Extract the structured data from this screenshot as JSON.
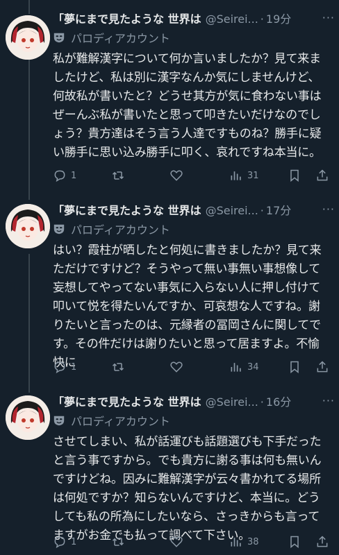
{
  "tweets": [
    {
      "display_name": "「夢にまで見たような 世界は",
      "handle": "@Seirei...",
      "separator": "·",
      "time": "19分",
      "label": "パロディアカウント",
      "text": "私が難解漢字について何か言いましたか？見て来ましたけど、私は別に漢字なんか気にしませんけど、何故私が書いたと？どうせ其方が気に食わない事はぜーんぶ私が書いたと思って叩きたいだけなのでしょう？貴方達はそう言う人達ですものね？勝手に疑い勝手に思い込み勝手に叩く、哀れですね本当に。",
      "replies": "1",
      "views": "31"
    },
    {
      "display_name": "「夢にまで見たような 世界は",
      "handle": "@Seirei...",
      "separator": "·",
      "time": "17分",
      "label": "パロディアカウント",
      "text": "はい？霞柱が晒したと何処に書きましたか？見て来ただけですけど？そうやって無い事無い事想像して妄想してやってない事気に入らない人に押し付けて叩いて悦を得たいんですか、可哀想な人ですね。謝りたいと言ったのは、元縁者の冨岡さんに関してです。その件だけは謝りたいと思って居ますよ。不愉快に",
      "replies": "1",
      "views": "34"
    },
    {
      "display_name": "「夢にまで見たような 世界は",
      "handle": "@Seirei...",
      "separator": "·",
      "time": "16分",
      "label": "パロディアカウント",
      "text": "させてしまい、私が話運びも話題選びも下手だったと言う事ですから。でも貴方に謝る事は何も無いんですけどね。因みに難解漢字が云々書かれてる場所は何処ですか？知らないんですけど、本当に。どうしても私の所為にしたいなら、さっきからも言ってますがお金でも払って調べて下さい。",
      "replies": "1",
      "views": "38"
    }
  ],
  "colors": {
    "background": "#15202b",
    "text": "#e7e9ea",
    "muted": "#8b98a5",
    "thread_line": "#38444d"
  }
}
